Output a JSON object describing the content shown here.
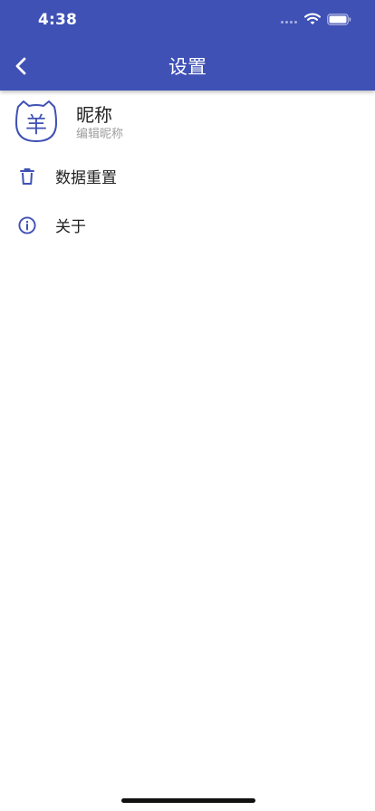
{
  "status_bar": {
    "time": "4:38"
  },
  "header": {
    "title": "设置",
    "background_color": "#3f51b5"
  },
  "profile": {
    "avatar_glyph": "羊",
    "nickname": "昵称",
    "subtitle": "编辑昵称",
    "accent_color": "#3f51b5"
  },
  "menu": {
    "items": [
      {
        "label": "数据重置",
        "icon": "trash-icon"
      },
      {
        "label": "关于",
        "icon": "info-icon"
      }
    ]
  }
}
